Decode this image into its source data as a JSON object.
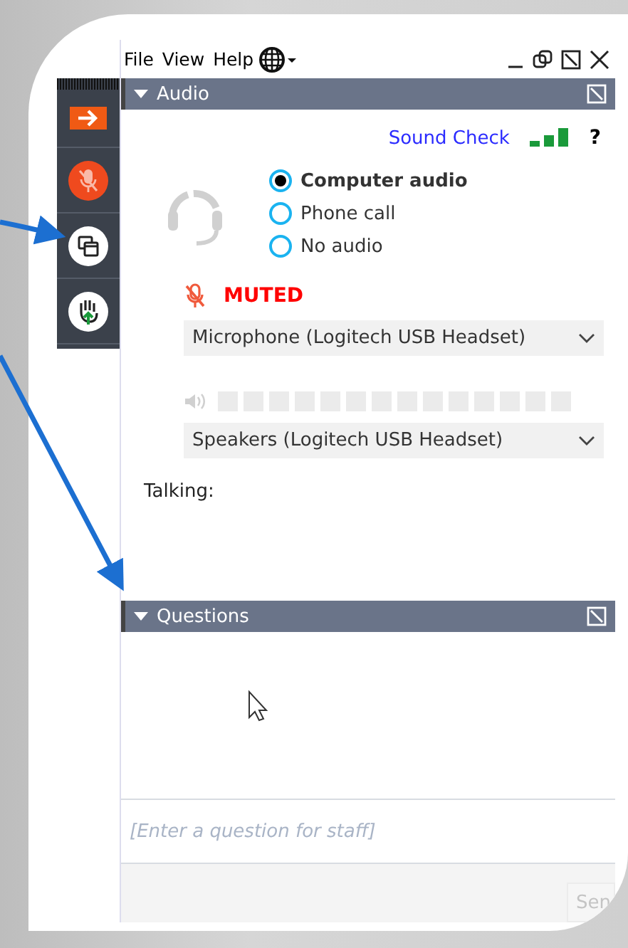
{
  "menu": [
    "File",
    "View",
    "Help"
  ],
  "toolbar": [
    {
      "kind": "collapse"
    },
    {
      "kind": "mic",
      "muted": true
    },
    {
      "kind": "screen"
    },
    {
      "kind": "hand"
    }
  ],
  "audio": {
    "title": "Audio",
    "sound_check": "Sound Check",
    "help": "?",
    "options": [
      {
        "label": "Computer audio",
        "selected": true
      },
      {
        "label": "Phone call",
        "selected": false
      },
      {
        "label": "No audio",
        "selected": false
      }
    ],
    "muted": true,
    "muted_label": "MUTED",
    "microphone": "Microphone (Logitech USB Headset)",
    "speaker_meter": {
      "level": 0
    },
    "speakers": "Speakers (Logitech USB Headset)",
    "talking": "Talking:"
  },
  "questions": {
    "title": "Questions",
    "placeholder": "[Enter a question for staff]",
    "send": "Sen"
  }
}
